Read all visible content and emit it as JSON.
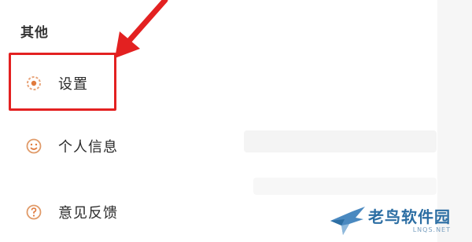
{
  "section": {
    "title": "其他"
  },
  "menu": {
    "items": [
      {
        "label": "设置",
        "icon": "gear-icon"
      },
      {
        "label": "个人信息",
        "icon": "smile-face-icon"
      },
      {
        "label": "意见反馈",
        "icon": "question-icon"
      }
    ]
  },
  "annotation": {
    "color": "#e32121"
  },
  "watermark": {
    "brand": "老鸟软件园",
    "domain": "LNQS.NET"
  },
  "colors": {
    "accent": "#e07a3c",
    "brand": "#2c6ea3"
  }
}
